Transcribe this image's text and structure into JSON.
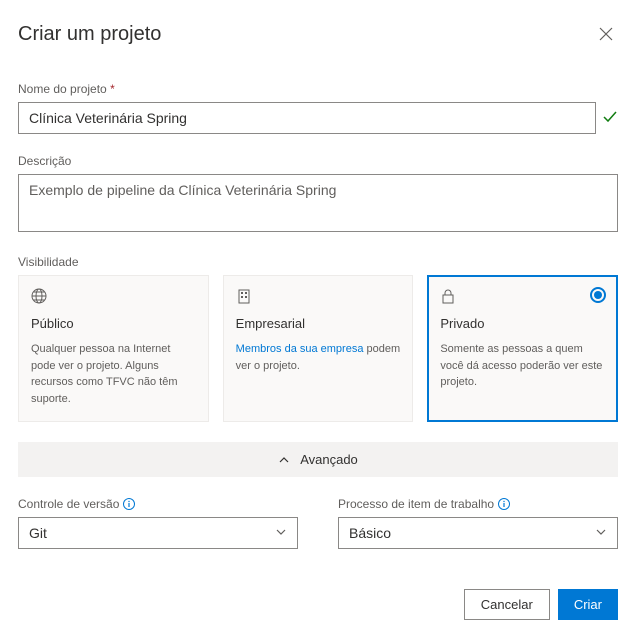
{
  "dialog": {
    "title": "Criar um projeto"
  },
  "projectName": {
    "label": "Nome do projeto",
    "value": "Clínica Veterinária Spring"
  },
  "description": {
    "label": "Descrição",
    "value": "Exemplo de pipeline da Clínica Veterinária Spring"
  },
  "visibility": {
    "label": "Visibilidade",
    "options": {
      "public": {
        "title": "Público",
        "desc": "Qualquer pessoa na Internet pode ver o projeto. Alguns recursos como TFVC não têm suporte."
      },
      "enterprise": {
        "title": "Empresarial",
        "linkText": "Membros da sua empresa",
        "descSuffix": " podem ver o projeto."
      },
      "private": {
        "title": "Privado",
        "desc": "Somente as pessoas a quem você dá acesso poderão ver este projeto."
      }
    }
  },
  "advanced": {
    "label": "Avançado",
    "versionControl": {
      "label": "Controle de versão",
      "value": "Git"
    },
    "workItem": {
      "label": "Processo de item de trabalho",
      "value": "Básico"
    }
  },
  "footer": {
    "cancel": "Cancelar",
    "create": "Criar"
  }
}
